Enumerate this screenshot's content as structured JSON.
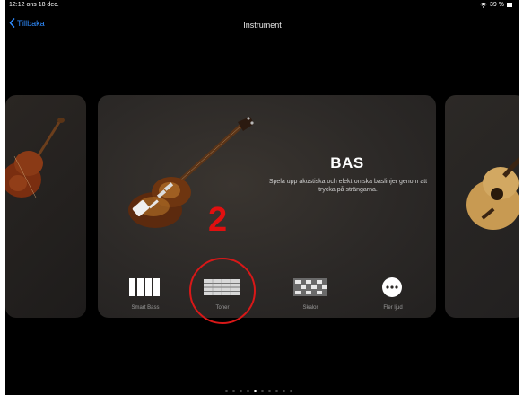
{
  "status_bar": {
    "time": "12:12  ons 18 dec.",
    "battery": "39 %"
  },
  "nav": {
    "back_label": "Tillbaka",
    "title": "Instrument"
  },
  "card": {
    "title": "BAS",
    "description": "Spela upp akustiska och elektroniska baslinjer genom att trycka på strängarna.",
    "options": [
      {
        "label": "Smart Bass",
        "icon": "smart-bass-keys-icon"
      },
      {
        "label": "Toner",
        "icon": "strings-grid-icon"
      },
      {
        "label": "Skalor",
        "icon": "scale-grid-icon"
      },
      {
        "label": "Fler ljud",
        "icon": "more-dots-icon"
      }
    ]
  },
  "annotation": {
    "number": "2",
    "color": "#e01010"
  },
  "pager": {
    "count": 10,
    "active_index": 4
  },
  "colors": {
    "accent": "#2f8cff",
    "background": "#000000",
    "card": "#2c2927"
  }
}
